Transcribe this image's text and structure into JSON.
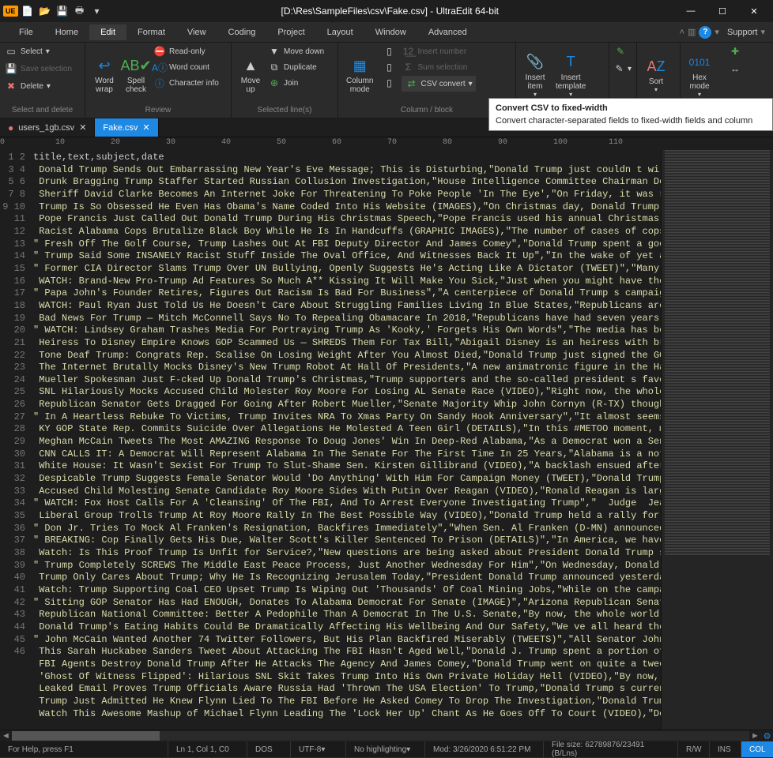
{
  "titlebar": {
    "title": "[D:\\Res\\SampleFiles\\csv\\Fake.csv] - UltraEdit 64-bit",
    "logo": "UE"
  },
  "menubar": {
    "items": [
      "File",
      "Home",
      "Edit",
      "Format",
      "View",
      "Coding",
      "Project",
      "Layout",
      "Window",
      "Advanced"
    ],
    "active_index": 2,
    "support": "Support"
  },
  "ribbon": {
    "select": {
      "select": "Select",
      "save_selection": "Save selection",
      "delete": "Delete",
      "footer": "Select and delete"
    },
    "review": {
      "word_wrap": "Word\nwrap",
      "spell_check": "Spell\ncheck",
      "read_only": "Read-only",
      "word_count": "Word count",
      "character_info": "Character info",
      "footer": "Review"
    },
    "lines": {
      "move_up": "Move\nup",
      "move_down": "Move down",
      "duplicate": "Duplicate",
      "join": "Join",
      "footer": "Selected line(s)"
    },
    "column": {
      "column_mode": "Column\nmode",
      "insert_number": "Insert number",
      "sum_selection": "Sum selection",
      "csv_convert": "CSV convert",
      "footer": "Column / block"
    },
    "insert": {
      "insert_item": "Insert\nitem",
      "insert_template": "Insert\ntemplate"
    },
    "sort": {
      "label": "Sort"
    },
    "hex": {
      "label": "Hex\nmode"
    }
  },
  "tooltip": {
    "title": "Convert CSV to fixed-width",
    "body": "Convert character-separated fields to fixed-width fields and column"
  },
  "tabs": [
    {
      "name": "users_1gb.csv",
      "active": false,
      "dirty": true
    },
    {
      "name": "Fake.csv",
      "active": true,
      "dirty": false
    }
  ],
  "ruler_marks": [
    0,
    10,
    20,
    30,
    40,
    50,
    60,
    70,
    80,
    90,
    100,
    110
  ],
  "code": {
    "header": "title,text,subject,date",
    "lines": [
      " Donald Trump Sends Out Embarrassing New Year's Eve Message; This is Disturbing,\"Donald Trump just couldn t wi",
      " Drunk Bragging Trump Staffer Started Russian Collusion Investigation,\"House Intelligence Committee Chairman De",
      " Sheriff David Clarke Becomes An Internet Joke For Threatening To Poke People 'In The Eye',\"On Friday, it was r",
      " Trump Is So Obsessed He Even Has Obama's Name Coded Into His Website (IMAGES),\"On Christmas day, Donald Trump",
      " Pope Francis Just Called Out Donald Trump During His Christmas Speech,\"Pope Francis used his annual Christmas",
      " Racist Alabama Cops Brutalize Black Boy While He Is In Handcuffs (GRAPHIC IMAGES),\"The number of cases of cops",
      "\" Fresh Off The Golf Course, Trump Lashes Out At FBI Deputy Director And James Comey\",\"Donald Trump spent a goo",
      "\" Trump Said Some INSANELY Racist Stuff Inside The Oval Office, And Witnesses Back It Up\",\"In the wake of yet a",
      "\" Former CIA Director Slams Trump Over UN Bullying, Openly Suggests He's Acting Like A Dictator (TWEET)\",\"Many ",
      " WATCH: Brand-New Pro-Trump Ad Features So Much A** Kissing It Will Make You Sick,\"Just when you might have tho",
      "\" Papa John's Founder Retires, Figures Out Racism Is Bad For Business\",\"A centerpiece of Donald Trump s campaig",
      " WATCH: Paul Ryan Just Told Us He Doesn't Care About Struggling Families Living In Blue States,\"Republicans are",
      " Bad News For Trump — Mitch McConnell Says No To Repealing Obamacare In 2018,\"Republicans have had seven years",
      "\" WATCH: Lindsey Graham Trashes Media For Portraying Trump As 'Kooky,' Forgets His Own Words\",\"The media has be",
      " Heiress To Disney Empire Knows GOP Scammed Us — SHREDS Them For Tax Bill,\"Abigail Disney is an heiress with br",
      " Tone Deaf Trump: Congrats Rep. Scalise On Losing Weight After You Almost Died,\"Donald Trump just signed the GO",
      " The Internet Brutally Mocks Disney's New Trump Robot At Hall Of Presidents,\"A new animatronic figure in the Ha",
      " Mueller Spokesman Just F-cked Up Donald Trump's Christmas,\"Trump supporters and the so-called president s favo",
      " SNL Hilariously Mocks Accused Child Molester Roy Moore For Losing AL Senate Race (VIDEO),\"Right now, the whole",
      " Republican Senator Gets Dragged For Going After Robert Mueller,\"Senate Majority Whip John Cornyn (R-TX) though",
      "\" In A Heartless Rebuke To Victims, Trump Invites NRA To Xmas Party On Sandy Hook Anniversary\",\"It almost seems",
      " KY GOP State Rep. Commits Suicide Over Allegations He Molested A Teen Girl (DETAILS),\"In this #METOO moment, m",
      " Meghan McCain Tweets The Most AMAZING Response To Doug Jones' Win In Deep-Red Alabama,\"As a Democrat won a Sen",
      " CNN CALLS IT: A Democrat Will Represent Alabama In The Senate For The First Time In 25 Years,\"Alabama is a not",
      " White House: It Wasn't Sexist For Trump To Slut-Shame Sen. Kirsten Gillibrand (VIDEO),\"A backlash ensued after",
      " Despicable Trump Suggests Female Senator Would 'Do Anything' With Him For Campaign Money (TWEET),\"Donald Trump",
      " Accused Child Molesting Senate Candidate Roy Moore Sides With Putin Over Reagan (VIDEO),\"Ronald Reagan is larg",
      "\" WATCH: Fox Host Calls For A 'Cleansing' Of The FBI, And To Arrest Everyone Investigating Trump\",\"  Judge  Jea",
      " Liberal Group Trolls Trump At Roy Moore Rally In The Best Possible Way (VIDEO),\"Donald Trump held a rally for ",
      "\" Don Jr. Tries To Mock Al Franken's Resignation, Backfires Immediately\",\"When Sen. Al Franken (D-MN) announced",
      "\" BREAKING: Cop Finally Gets His Due, Walter Scott's Killer Sentenced To Prison (DETAILS)\",\"In America, we have",
      " Watch: Is This Proof Trump Is Unfit for Service?,\"New questions are being asked about President Donald Trump s",
      "\" Trump Completely SCREWS The Middle East Peace Process, Just Another Wednesday For Him\",\"On Wednesday, Donald",
      " Trump Only Cares About Trump; Why He Is Recognizing Jerusalem Today,\"President Donald Trump announced yesterda",
      " Watch: Trump Supporting Coal CEO Upset Trump Is Wiping Out 'Thousands' Of Coal Mining Jobs,\"While on the campa",
      "\" Sitting GOP Senator Has Had ENOUGH, Donates To Alabama Democrat For Senate (IMAGE)\",\"Arizona Republican Senat",
      " Republican National Committee: Better A Pedophile Than A Democrat In The U.S. Senate,\"By now, the whole world",
      " Donald Trump's Eating Habits Could Be Dramatically Affecting His Wellbeing And Our Safety,\"We ve all heard the",
      "\" John McCain Wanted Another 74 Twitter Followers, But His Plan Backfired Miserably (TWEETS)\",\"All Senator John",
      " This Sarah Huckabee Sanders Tweet About Attacking The FBI Hasn't Aged Well,\"Donald J. Trump spent a portion of",
      " FBI Agents Destroy Donald Trump After He Attacks The Agency And James Comey,\"Donald Trump went on quite a twee",
      " 'Ghost Of Witness Flipped': Hilarious SNL Skit Takes Trump Into His Own Private Holiday Hell (VIDEO),\"By now, ",
      " Leaked Email Proves Trump Officials Aware Russia Had 'Thrown The USA Election' To Trump,\"Donald Trump s curren",
      " Trump Just Admitted He Knew Flynn Lied To The FBI Before He Asked Comey To Drop The Investigation,\"Donald Trum",
      " Watch This Awesome Mashup of Michael Flynn Leading The 'Lock Her Up' Chant As He Goes Off To Court (VIDEO),\"Do"
    ]
  },
  "statusbar": {
    "help": "For Help, press F1",
    "pos": "Ln 1, Col 1, C0",
    "dos": "DOS",
    "enc": "UTF-8",
    "hl": "No highlighting",
    "mod": "Mod: 3/26/2020 6:51:22 PM",
    "size": "File size: 62789876/23491 (B/Lns)",
    "rw": "R/W",
    "ins": "INS",
    "col": "COL"
  }
}
